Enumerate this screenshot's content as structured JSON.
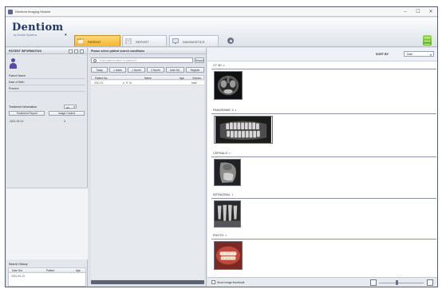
{
  "window": {
    "title": "Dentiom Imaging Module",
    "controls": [
      "–",
      "☐",
      "✕"
    ]
  },
  "brand": {
    "name": "Dentiom",
    "tagline": "by Dental Systems"
  },
  "tabs": [
    {
      "label": "PATIENT",
      "active": true
    },
    {
      "label": "REPORT",
      "active": false
    },
    {
      "label": "DIAGNOSTICS",
      "active": false
    }
  ],
  "left_panel": {
    "header": "PATIENT INFORMATION",
    "fields": [
      "Patient Name",
      "Date of Birth",
      "Practice"
    ],
    "treatment_label": "Treatment Information",
    "treatment_value": "All",
    "buttons": [
      "Treatment Report",
      "Image Control"
    ],
    "treatment_row": [
      "2021-09-13",
      "3"
    ],
    "search_history": {
      "title": "Search History",
      "columns": [
        "Date Ser.",
        "Patient",
        "Age"
      ],
      "rows": [
        [
          "2021-09-13"
        ]
      ]
    }
  },
  "mid_panel": {
    "header": "Please select patient search conditions",
    "search_placeholder": "Enter patient name or patient ID",
    "go_label": "Search",
    "filters": [
      "Today",
      "1 Week",
      "1 Month",
      "3 Month",
      "Date Sel.",
      "Register"
    ],
    "columns": [
      "Patient No.",
      "Name",
      "Age",
      "Gender"
    ],
    "rows": [
      [
        "2021-01",
        "A. R. M.",
        "",
        "Male"
      ]
    ]
  },
  "right_panel": {
    "sort_label": "SORT BY",
    "sort_value": "Date",
    "groups": [
      {
        "label": "CT 3D"
      },
      {
        "label": "PANORAMIC 2"
      },
      {
        "label": "CEPHALO"
      },
      {
        "label": "INTRAORAL"
      },
      {
        "label": "PHOTO"
      }
    ]
  },
  "status_bar": {
    "checkbox_label": "Show image thumbnail"
  },
  "colors": {
    "accent_active_tab": "#f6b62e",
    "brand_navy": "#23376a",
    "green_button": "#5fae2a",
    "person_icon": "#5a4aa8"
  }
}
